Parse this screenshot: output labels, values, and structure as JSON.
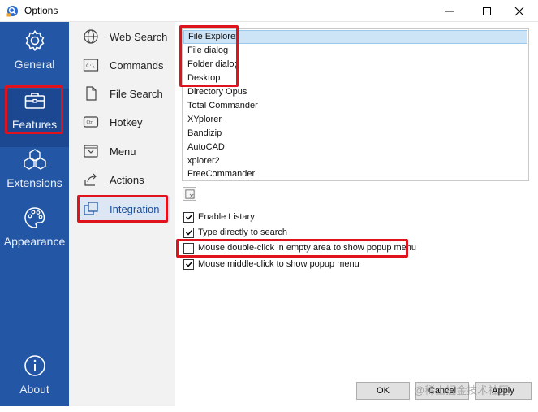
{
  "window": {
    "title": "Options",
    "app_icon": "listary-icon",
    "controls": [
      "minimize-icon",
      "maximize-icon",
      "close-icon"
    ]
  },
  "nav": {
    "items": [
      {
        "label": "General",
        "icon": "gear-icon"
      },
      {
        "label": "Features",
        "icon": "toolbox-icon",
        "active": true
      },
      {
        "label": "Extensions",
        "icon": "cubes-icon"
      },
      {
        "label": "Appearance",
        "icon": "palette-icon"
      }
    ],
    "about": {
      "label": "About",
      "icon": "info-icon"
    }
  },
  "subnav": {
    "items": [
      {
        "label": "Web Search",
        "icon": "globe-icon"
      },
      {
        "label": "Commands",
        "icon": "terminal-icon"
      },
      {
        "label": "File Search",
        "icon": "file-icon"
      },
      {
        "label": "Hotkey",
        "icon": "ctrl-key-icon"
      },
      {
        "label": "Menu",
        "icon": "menu-icon"
      },
      {
        "label": "Actions",
        "icon": "share-icon"
      },
      {
        "label": "Integration",
        "icon": "integration-icon",
        "active": true
      }
    ],
    "ctrl_label": "Ctrl",
    "cmd_label": "C:\\"
  },
  "integration": {
    "apps": [
      "File Explorer",
      "File dialog",
      "Folder dialog",
      "Desktop",
      "Directory Opus",
      "Total Commander",
      "XYplorer",
      "Bandizip",
      "AutoCAD",
      "xplorer2",
      "FreeCommander"
    ],
    "selected_index": 0,
    "clear_button_icon": "clear-icon",
    "options": [
      {
        "label": "Enable Listary",
        "checked": true
      },
      {
        "label": "Type directly to search",
        "checked": true
      },
      {
        "label": "Mouse double-click in empty area to show popup menu",
        "checked": false
      },
      {
        "label": "Mouse middle-click to show popup menu",
        "checked": true
      }
    ]
  },
  "buttons": {
    "ok": "OK",
    "cancel": "Cancel",
    "apply": "Apply"
  },
  "watermark": "@稀土掘金技术社区",
  "colors": {
    "nav_bg": "#2357a5",
    "nav_active_bg": "#1b4890",
    "subnav_bg": "#f2f2f2",
    "highlight_red": "#e0121c",
    "selection_bg": "#cde4f7"
  }
}
